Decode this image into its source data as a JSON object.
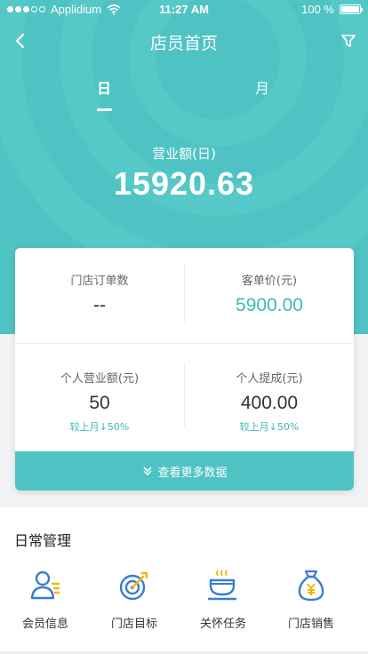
{
  "status": {
    "carrier": "Applidium",
    "time": "11:27 AM",
    "battery": "100 %"
  },
  "nav": {
    "title": "店员首页"
  },
  "tabs": [
    {
      "label": "日"
    },
    {
      "label": "月"
    }
  ],
  "revenue": {
    "label": "营业额(日)",
    "value": "15920.63"
  },
  "stats": {
    "store_orders": {
      "label": "门店订单数",
      "value": "--"
    },
    "avg_price": {
      "label": "客单价(元)",
      "value": "5900.00"
    },
    "personal_revenue": {
      "label": "个人营业额(元)",
      "value": "50",
      "compare": "较上月↓50%"
    },
    "personal_commission": {
      "label": "个人提成(元)",
      "value": "400.00",
      "compare": "较上月↓50%"
    }
  },
  "more_button": {
    "label": "查看更多数据"
  },
  "daily": {
    "title": "日常管理",
    "items": [
      {
        "label": "会员信息",
        "icon": "member-icon"
      },
      {
        "label": "门店目标",
        "icon": "target-icon"
      },
      {
        "label": "关怀任务",
        "icon": "coffee-cup-icon"
      },
      {
        "label": "门店销售",
        "icon": "money-bag-icon"
      }
    ]
  },
  "colors": {
    "accent": "#4fc3c3",
    "accent_text": "#3fb7b7",
    "icon_blue": "#3a7bd5",
    "icon_yellow": "#f5b800"
  }
}
